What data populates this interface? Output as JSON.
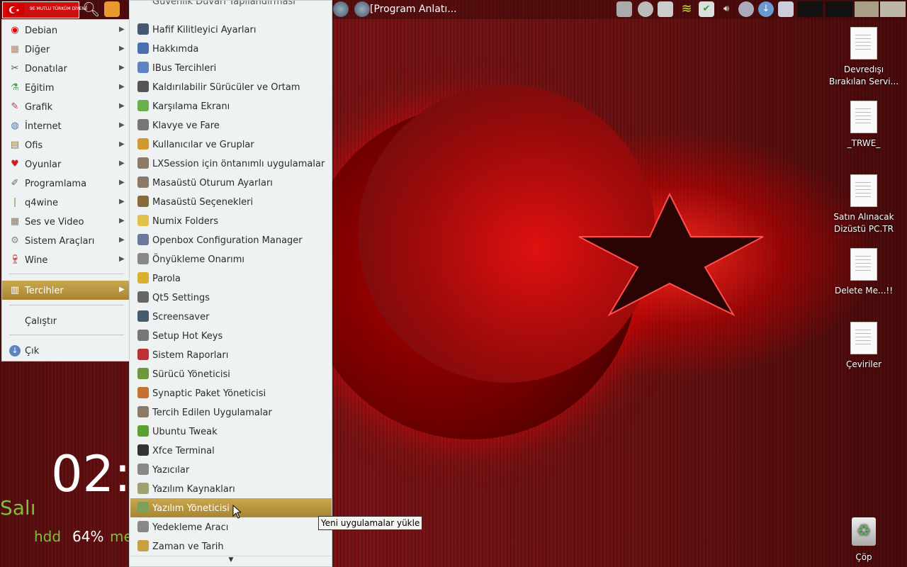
{
  "panel": {
    "start_banner": "9E MUTLU TÜRKÜM DİYENE",
    "task_title": "[Program Anlatı..."
  },
  "categories": [
    {
      "label": "Debian",
      "icon": "debian-icon"
    },
    {
      "label": "Diğer",
      "icon": "other-icon"
    },
    {
      "label": "Donatılar",
      "icon": "accessories-icon"
    },
    {
      "label": "Eğitim",
      "icon": "education-icon"
    },
    {
      "label": "Grafik",
      "icon": "graphics-icon"
    },
    {
      "label": "İnternet",
      "icon": "internet-icon"
    },
    {
      "label": "Ofis",
      "icon": "office-icon"
    },
    {
      "label": "Oyunlar",
      "icon": "games-icon"
    },
    {
      "label": "Programlama",
      "icon": "programming-icon"
    },
    {
      "label": "q4wine",
      "icon": "wine-glass-icon"
    },
    {
      "label": "Ses ve Video",
      "icon": "multimedia-icon"
    },
    {
      "label": "Sistem Araçları",
      "icon": "system-tools-icon"
    },
    {
      "label": "Wine",
      "icon": "wine-icon"
    }
  ],
  "selected_category": "Tercihler",
  "run_label": "Çalıştır",
  "quit_label": "Çık",
  "submenu_partial_top": "Güvenlik Duvarı Yapılandırması",
  "submenu": [
    {
      "label": "Hafif Kilitleyici Ayarları",
      "icon": "lock-settings-icon",
      "color": "#445a6e"
    },
    {
      "label": "Hakkımda",
      "icon": "about-me-icon",
      "color": "#4a6fb0"
    },
    {
      "label": "IBus Tercihleri",
      "icon": "ibus-icon",
      "color": "#5f84c6"
    },
    {
      "label": "Kaldırılabilir Sürücüler ve Ortam",
      "icon": "removable-drive-icon",
      "color": "#555"
    },
    {
      "label": "Karşılama Ekranı",
      "icon": "greeter-icon",
      "color": "#6ab04c"
    },
    {
      "label": "Klavye ve Fare",
      "icon": "keyboard-mouse-icon",
      "color": "#777"
    },
    {
      "label": "Kullanıcılar ve Gruplar",
      "icon": "users-groups-icon",
      "color": "#d19a2c"
    },
    {
      "label": "LXSession için öntanımlı uygulamalar",
      "icon": "lxsession-icon",
      "color": "#8a7a66"
    },
    {
      "label": "Masaüstü Oturum Ayarları",
      "icon": "session-settings-icon",
      "color": "#8a7a66"
    },
    {
      "label": "Masaüstü Seçenekleri",
      "icon": "desktop-options-icon",
      "color": "#8a6a3a"
    },
    {
      "label": "Numix Folders",
      "icon": "numix-folders-icon",
      "color": "#e0c24a"
    },
    {
      "label": "Openbox Configuration Manager",
      "icon": "openbox-icon",
      "color": "#6a7a9a"
    },
    {
      "label": "Önyükleme Onarımı",
      "icon": "boot-repair-icon",
      "color": "#888"
    },
    {
      "label": "Parola",
      "icon": "password-icon",
      "color": "#d8b030"
    },
    {
      "label": "Qt5 Settings",
      "icon": "qt-settings-icon",
      "color": "#666"
    },
    {
      "label": "Screensaver",
      "icon": "screensaver-icon",
      "color": "#445a6e"
    },
    {
      "label": "Setup Hot Keys",
      "icon": "hotkeys-icon",
      "color": "#777"
    },
    {
      "label": "Sistem Raporları",
      "icon": "system-reports-icon",
      "color": "#c03030"
    },
    {
      "label": "Sürücü Yöneticisi",
      "icon": "driver-manager-icon",
      "color": "#6a9a3a"
    },
    {
      "label": "Synaptic Paket Yöneticisi",
      "icon": "synaptic-icon",
      "color": "#c87030"
    },
    {
      "label": "Tercih Edilen Uygulamalar",
      "icon": "preferred-apps-icon",
      "color": "#8a7a66"
    },
    {
      "label": "Ubuntu Tweak",
      "icon": "ubuntu-tweak-icon",
      "color": "#5aa02c"
    },
    {
      "label": "Xfce Terminal",
      "icon": "terminal-icon",
      "color": "#333"
    },
    {
      "label": "Yazıcılar",
      "icon": "printer-icon",
      "color": "#888"
    },
    {
      "label": "Yazılım Kaynakları",
      "icon": "software-sources-icon",
      "color": "#a0a070"
    },
    {
      "label": "Yazılım Yöneticisi",
      "icon": "software-manager-icon",
      "color": "#7aa05a"
    },
    {
      "label": "Yedekleme Aracı",
      "icon": "backup-icon",
      "color": "#888"
    },
    {
      "label": "Zaman ve Tarih",
      "icon": "time-date-icon",
      "color": "#c8a040"
    }
  ],
  "selected_submenu": "Yazılım Yöneticisi",
  "tooltip": "Yeni uygulamalar yükle",
  "desktop_icons": [
    {
      "line1": "Devredışı",
      "line2": "Bırakılan Servi..."
    },
    {
      "line1": "_TRWE_",
      "line2": ""
    },
    {
      "line1": "Satın Alınacak",
      "line2": "Dizüstü PC.TR"
    },
    {
      "line1": "Delete Me...!!",
      "line2": ""
    },
    {
      "line1": "Çeviriler",
      "line2": ""
    }
  ],
  "trash_label": "Çöp",
  "conky": {
    "clock": "02:",
    "day": "Salı",
    "hdd_label": "hdd",
    "hdd_value": "64%",
    "mem_label": "me"
  }
}
